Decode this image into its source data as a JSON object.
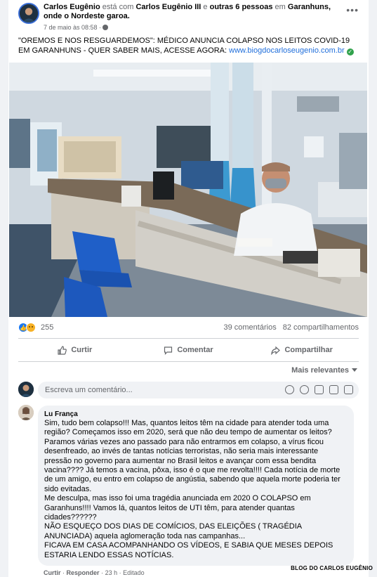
{
  "post": {
    "author": "Carlos Eugênio",
    "with_word": "está com",
    "tagged": "Carlos Eugênio III",
    "and_word": "e",
    "others": "outras 6 pessoas",
    "in_word": "em",
    "location": "Garanhuns, onde o Nordeste garoa.",
    "timestamp": "7 de maio às 08:58 ·",
    "text": "\"OREMOS E NOS RESGUARDEMOS\": MÉDICO ANUNCIA COLAPSO NOS LEITOS COVID-19 EM GARANHUNS - QUER SABER MAIS, ACESSE AGORA: ",
    "link": "www.biogdocarloseugenio.com.br",
    "icons": {
      "privacy": "globe-icon",
      "menu": "more-dots-icon",
      "verified": "check-circle-icon"
    }
  },
  "stats": {
    "reaction_count": "255",
    "comments": "39 comentários",
    "shares": "82 compartilhamentos",
    "reaction_icons": [
      "like-icon",
      "sad-icon"
    ]
  },
  "actions": {
    "like": "Curtir",
    "comment": "Comentar",
    "share": "Compartilhar"
  },
  "sort": {
    "label": "Mais relevantes"
  },
  "composer": {
    "placeholder": "Escreva um comentário...",
    "tools": [
      "sticker-icon",
      "emoji-icon",
      "camera-icon",
      "gif-icon",
      "sticker-square-icon"
    ]
  },
  "comment": {
    "author": "Lu França",
    "body": "Sim, tudo bem colapso!!! Mas, quantos leitos têm na cidade para atender toda uma região? Começamos isso em 2020, será que não deu tempo de aumentar os leitos? Paramos várias vezes ano passado para não entrarmos em colapso, a vírus ficou desenfreado, ao invés de tantas notícias terroristas, não seria mais interessante pressão no governo para aumentar no Brasil leitos e avançar com essa bendita vacina???? Já temos a vacina, pôxa, isso é o que me revolta!!!! Cada notícia de morte de um amigo, eu entro em colapso de angústia, sabendo que aquela morte poderia ter sido evitadas.\nMe desculpa, mas isso foi uma tragédia anunciada em 2020 O COLAPSO em Garanhuns!!!! Vamos lá, quantos leitos de UTI têm, para atender quantas cidades??????\nNÃO ESQUEÇO DOS DIAS DE COMÍCIOS, DAS ELEIÇÕES ( TRAGÉDIA ANUNCIADA) aqueIa aglomeração toda nas campanhas...\nFICAVA EM CASA ACOMPANHANDO OS VÍDEOS, E SABIA QUE MESES DEPOIS ESTARIA LENDO ESSAS NOTÍCIAS.",
    "like": "Curtir",
    "reply": "Responder",
    "time": "23 h",
    "edited": "Editado",
    "sep": "·"
  },
  "watermark": "BLOG DO CARLOS EUGÊNIO",
  "colors": {
    "link": "#216fdb",
    "like": "#1877f2",
    "muted": "#65676b",
    "bubble": "#f0f2f5"
  }
}
